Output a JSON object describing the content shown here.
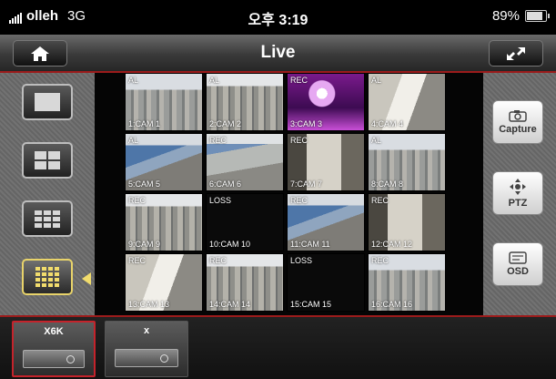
{
  "status_bar": {
    "carrier": "olleh",
    "network": "3G",
    "time": "오후 3:19",
    "battery": "89%"
  },
  "title_bar": {
    "title": "Live",
    "home_icon": "home-icon",
    "expand_icon": "expand-arrows-icon"
  },
  "layout_buttons": [
    {
      "name": "single",
      "icon": "layout-1x1-icon"
    },
    {
      "name": "quad",
      "icon": "layout-2x2-icon"
    },
    {
      "name": "nine",
      "icon": "layout-3x3-icon"
    },
    {
      "name": "sixteen",
      "icon": "layout-4x4-icon",
      "active": true
    }
  ],
  "tools": {
    "capture": "Capture",
    "ptz": "PTZ",
    "osd": "OSD"
  },
  "cameras": [
    {
      "top": "AL",
      "label": "1:CAM 1"
    },
    {
      "top": "AL",
      "label": "2:CAM 2"
    },
    {
      "top": "REC",
      "label": "3:CAM 3"
    },
    {
      "top": "AL",
      "label": "4:CAM 4"
    },
    {
      "top": "AL",
      "label": "5:CAM 5"
    },
    {
      "top": "REC",
      "label": "6:CAM 6"
    },
    {
      "top": "REC",
      "label": "7:CAM 7"
    },
    {
      "top": "AL",
      "label": "8:CAM 8"
    },
    {
      "top": "REC",
      "label": "9:CAM 9"
    },
    {
      "top": "LOSS",
      "label": "10:CAM 10"
    },
    {
      "top": "REC",
      "label": "11:CAM 11"
    },
    {
      "top": "REC",
      "label": "12:CAM 12"
    },
    {
      "top": "REC",
      "label": "13:CAM 13"
    },
    {
      "top": "REC",
      "label": "14:CAM 14"
    },
    {
      "top": "LOSS",
      "label": "15:CAM 15"
    },
    {
      "top": "REC",
      "label": "16:CAM 16"
    }
  ],
  "devices": [
    {
      "label": "X6K",
      "selected": true
    },
    {
      "label": "x",
      "selected": false
    }
  ],
  "colors": {
    "accent_red": "#c4232b",
    "active_yellow": "#e8d36a"
  }
}
